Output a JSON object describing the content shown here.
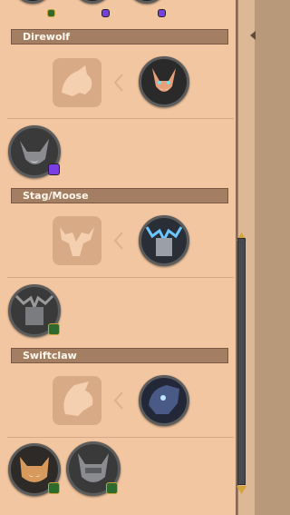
{
  "sections": [
    {
      "title": "Direwolf"
    },
    {
      "title": "Stag/Moose"
    },
    {
      "title": "Swiftclaw"
    }
  ],
  "icons": {
    "twitch_badge": "twitch-badge-icon",
    "gold_badge": "gold-tier-badge-icon",
    "unlock_arrow": "chevron-left-icon"
  },
  "colors": {
    "panel_bg": "#f2c6a0",
    "header_bg": "#a47e63",
    "silhouette_bg": "#d9aa86",
    "scrollbar": "#474a4f",
    "accent_gold": "#c9a23a",
    "twitch_purple": "#7b3ee0"
  }
}
